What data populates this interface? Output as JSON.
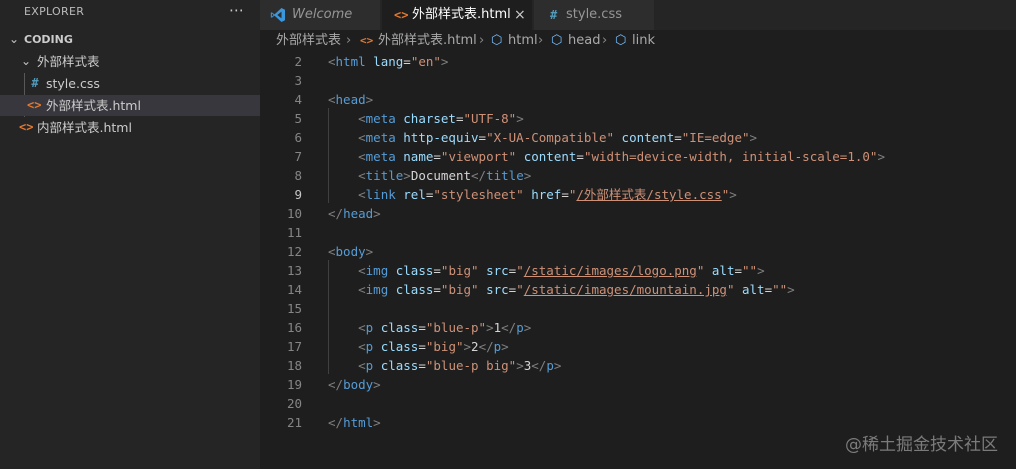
{
  "explorer": {
    "title": "EXPLORER",
    "more_icon": "ellipsis-icon",
    "root": "CODING",
    "tree": [
      {
        "label": "外部样式表",
        "type": "folder"
      },
      {
        "label": "style.css",
        "type": "css",
        "icon_text": "#"
      },
      {
        "label": "外部样式表.html",
        "type": "html",
        "icon_text": "<>"
      },
      {
        "label": "内部样式表.html",
        "type": "html",
        "icon_text": "<>"
      }
    ]
  },
  "tabs": [
    {
      "label": "Welcome",
      "icon": "vscode-logo-icon"
    },
    {
      "label": "外部样式表.html",
      "icon_text": "<>",
      "close": "×"
    },
    {
      "label": "style.css",
      "icon_text": "#"
    }
  ],
  "breadcrumb": [
    "外部样式表",
    "外部样式表.html",
    "html",
    "head",
    "link"
  ],
  "editor": {
    "current_line": 9,
    "lines": [
      {
        "n": "2",
        "tokens": [
          [
            "t",
            "<"
          ],
          [
            "tn",
            "html"
          ],
          [
            "tx",
            " "
          ],
          [
            "an",
            "lang"
          ],
          [
            "tx",
            "="
          ],
          [
            "av",
            "\"en\""
          ],
          [
            "t",
            ">"
          ]
        ]
      },
      {
        "n": "3",
        "tokens": []
      },
      {
        "n": "4",
        "tokens": [
          [
            "t",
            "<"
          ],
          [
            "tn",
            "head"
          ],
          [
            "t",
            ">"
          ]
        ]
      },
      {
        "n": "5",
        "tokens": [
          [
            "tx",
            "    "
          ],
          [
            "t",
            "<"
          ],
          [
            "tn",
            "meta"
          ],
          [
            "tx",
            " "
          ],
          [
            "an",
            "charset"
          ],
          [
            "tx",
            "="
          ],
          [
            "av",
            "\"UTF-8\""
          ],
          [
            "t",
            ">"
          ]
        ]
      },
      {
        "n": "6",
        "tokens": [
          [
            "tx",
            "    "
          ],
          [
            "t",
            "<"
          ],
          [
            "tn",
            "meta"
          ],
          [
            "tx",
            " "
          ],
          [
            "an",
            "http-equiv"
          ],
          [
            "tx",
            "="
          ],
          [
            "av",
            "\"X-UA-Compatible\""
          ],
          [
            "tx",
            " "
          ],
          [
            "an",
            "content"
          ],
          [
            "tx",
            "="
          ],
          [
            "av",
            "\"IE=edge\""
          ],
          [
            "t",
            ">"
          ]
        ]
      },
      {
        "n": "7",
        "tokens": [
          [
            "tx",
            "    "
          ],
          [
            "t",
            "<"
          ],
          [
            "tn",
            "meta"
          ],
          [
            "tx",
            " "
          ],
          [
            "an",
            "name"
          ],
          [
            "tx",
            "="
          ],
          [
            "av",
            "\"viewport\""
          ],
          [
            "tx",
            " "
          ],
          [
            "an",
            "content"
          ],
          [
            "tx",
            "="
          ],
          [
            "av",
            "\"width=device-width, initial-scale=1.0\""
          ],
          [
            "t",
            ">"
          ]
        ]
      },
      {
        "n": "8",
        "tokens": [
          [
            "tx",
            "    "
          ],
          [
            "t",
            "<"
          ],
          [
            "tn",
            "title"
          ],
          [
            "t",
            ">"
          ],
          [
            "tx",
            "Document"
          ],
          [
            "t",
            "</"
          ],
          [
            "tn",
            "title"
          ],
          [
            "t",
            ">"
          ]
        ]
      },
      {
        "n": "9",
        "tokens": [
          [
            "tx",
            "    "
          ],
          [
            "t",
            "<"
          ],
          [
            "tn",
            "link"
          ],
          [
            "tx",
            " "
          ],
          [
            "an",
            "rel"
          ],
          [
            "tx",
            "="
          ],
          [
            "av",
            "\"stylesheet\""
          ],
          [
            "tx",
            " "
          ],
          [
            "an",
            "href"
          ],
          [
            "tx",
            "="
          ],
          [
            "av",
            "\""
          ],
          [
            "avu",
            "/外部样式表/style.css"
          ],
          [
            "av",
            "\""
          ],
          [
            "t",
            ">"
          ]
        ]
      },
      {
        "n": "10",
        "tokens": [
          [
            "t",
            "</"
          ],
          [
            "tn",
            "head"
          ],
          [
            "t",
            ">"
          ]
        ]
      },
      {
        "n": "11",
        "tokens": []
      },
      {
        "n": "12",
        "tokens": [
          [
            "t",
            "<"
          ],
          [
            "tn",
            "body"
          ],
          [
            "t",
            ">"
          ]
        ]
      },
      {
        "n": "13",
        "tokens": [
          [
            "tx",
            "    "
          ],
          [
            "t",
            "<"
          ],
          [
            "tn",
            "img"
          ],
          [
            "tx",
            " "
          ],
          [
            "an",
            "class"
          ],
          [
            "tx",
            "="
          ],
          [
            "av",
            "\"big\""
          ],
          [
            "tx",
            " "
          ],
          [
            "an",
            "src"
          ],
          [
            "tx",
            "="
          ],
          [
            "av",
            "\""
          ],
          [
            "avu",
            "/static/images/logo.png"
          ],
          [
            "av",
            "\""
          ],
          [
            "tx",
            " "
          ],
          [
            "an",
            "alt"
          ],
          [
            "tx",
            "="
          ],
          [
            "av",
            "\"\""
          ],
          [
            "t",
            ">"
          ]
        ]
      },
      {
        "n": "14",
        "tokens": [
          [
            "tx",
            "    "
          ],
          [
            "t",
            "<"
          ],
          [
            "tn",
            "img"
          ],
          [
            "tx",
            " "
          ],
          [
            "an",
            "class"
          ],
          [
            "tx",
            "="
          ],
          [
            "av",
            "\"big\""
          ],
          [
            "tx",
            " "
          ],
          [
            "an",
            "src"
          ],
          [
            "tx",
            "="
          ],
          [
            "av",
            "\""
          ],
          [
            "avu",
            "/static/images/mountain.jpg"
          ],
          [
            "av",
            "\""
          ],
          [
            "tx",
            " "
          ],
          [
            "an",
            "alt"
          ],
          [
            "tx",
            "="
          ],
          [
            "av",
            "\"\""
          ],
          [
            "t",
            ">"
          ]
        ]
      },
      {
        "n": "15",
        "tokens": []
      },
      {
        "n": "16",
        "tokens": [
          [
            "tx",
            "    "
          ],
          [
            "t",
            "<"
          ],
          [
            "tn",
            "p"
          ],
          [
            "tx",
            " "
          ],
          [
            "an",
            "class"
          ],
          [
            "tx",
            "="
          ],
          [
            "av",
            "\"blue-p\""
          ],
          [
            "t",
            ">"
          ],
          [
            "tx",
            "1"
          ],
          [
            "t",
            "</"
          ],
          [
            "tn",
            "p"
          ],
          [
            "t",
            ">"
          ]
        ]
      },
      {
        "n": "17",
        "tokens": [
          [
            "tx",
            "    "
          ],
          [
            "t",
            "<"
          ],
          [
            "tn",
            "p"
          ],
          [
            "tx",
            " "
          ],
          [
            "an",
            "class"
          ],
          [
            "tx",
            "="
          ],
          [
            "av",
            "\"big\""
          ],
          [
            "t",
            ">"
          ],
          [
            "tx",
            "2"
          ],
          [
            "t",
            "</"
          ],
          [
            "tn",
            "p"
          ],
          [
            "t",
            ">"
          ]
        ]
      },
      {
        "n": "18",
        "tokens": [
          [
            "tx",
            "    "
          ],
          [
            "t",
            "<"
          ],
          [
            "tn",
            "p"
          ],
          [
            "tx",
            " "
          ],
          [
            "an",
            "class"
          ],
          [
            "tx",
            "="
          ],
          [
            "av",
            "\"blue-p big\""
          ],
          [
            "t",
            ">"
          ],
          [
            "tx",
            "3"
          ],
          [
            "t",
            "</"
          ],
          [
            "tn",
            "p"
          ],
          [
            "t",
            ">"
          ]
        ]
      },
      {
        "n": "19",
        "tokens": [
          [
            "t",
            "</"
          ],
          [
            "tn",
            "body"
          ],
          [
            "t",
            ">"
          ]
        ]
      },
      {
        "n": "20",
        "tokens": []
      },
      {
        "n": "21",
        "tokens": [
          [
            "t",
            "</"
          ],
          [
            "tn",
            "html"
          ],
          [
            "t",
            ">"
          ]
        ]
      }
    ]
  },
  "watermark": "@稀土掘金技术社区",
  "colors": {
    "tag_bracket": "#808080",
    "tag_name": "#569cd6",
    "attr_name": "#9cdcfe",
    "attr_value": "#ce9178",
    "text": "#d4d4d4",
    "html_icon": "#e37933",
    "css_icon": "#519aba"
  }
}
